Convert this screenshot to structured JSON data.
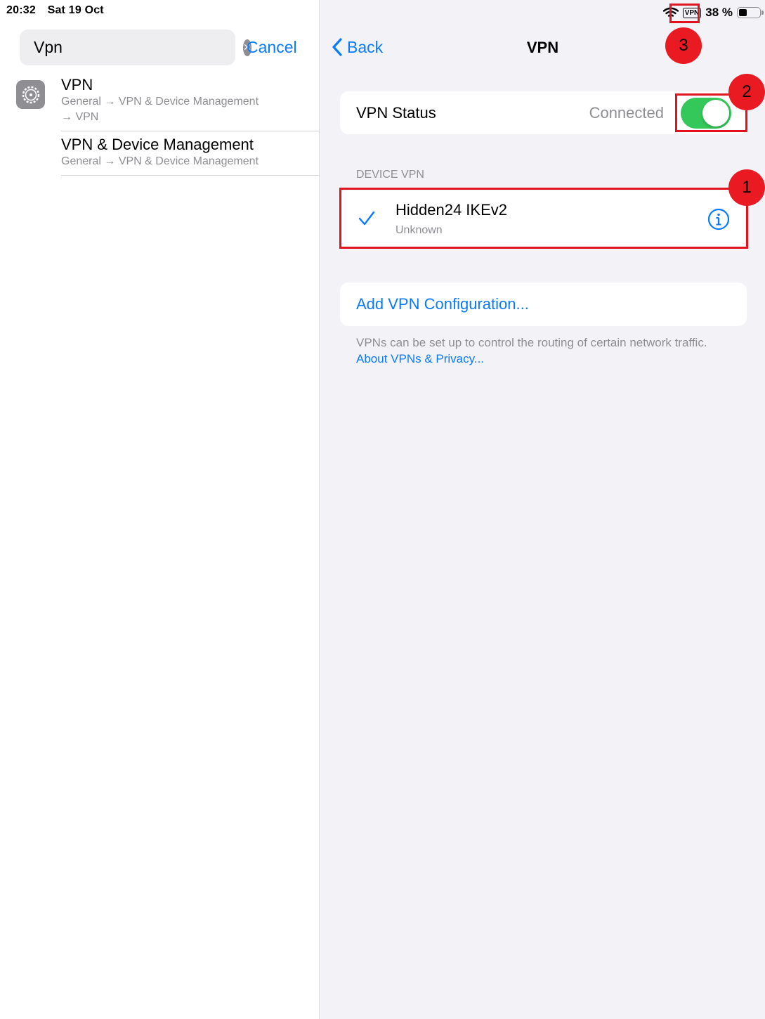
{
  "status_bar": {
    "time": "20:32",
    "date": "Sat 19 Oct",
    "vpn_indicator": "VPN",
    "battery_text": "38 %",
    "battery_level": 0.38
  },
  "search": {
    "value": "Vpn",
    "cancel_label": "Cancel"
  },
  "results": [
    {
      "title": "VPN",
      "path_line1": "General → VPN & Device Management",
      "path_line2": "→ VPN"
    },
    {
      "title": "VPN & Device Management",
      "path_line1": "General → VPN & Device Management"
    }
  ],
  "nav": {
    "back_label": "Back",
    "title": "VPN"
  },
  "vpn_status": {
    "label": "VPN Status",
    "value": "Connected",
    "toggle_on": true
  },
  "device_vpn": {
    "header": "DEVICE VPN",
    "name": "Hidden24 IKEv2",
    "status": "Unknown"
  },
  "add_config_label": "Add VPN Configuration...",
  "footnote": {
    "text": "VPNs can be set up to control the routing of certain network traffic.",
    "link": "About VPNs & Privacy..."
  },
  "annotations": [
    "1",
    "2",
    "3"
  ],
  "colors": {
    "accent": "#0a7aff",
    "toggle_on": "#34c759",
    "annotation": "#e0141e"
  }
}
